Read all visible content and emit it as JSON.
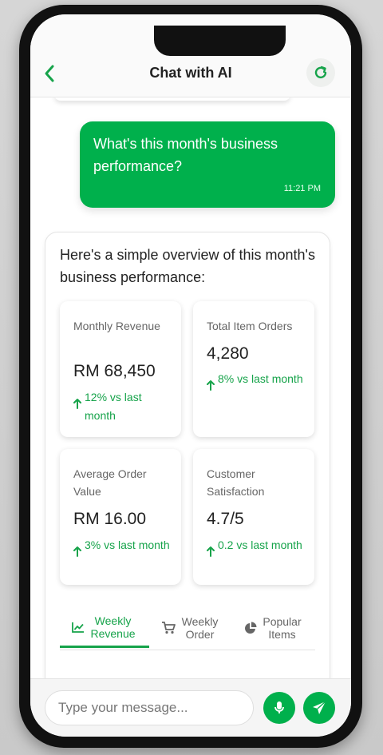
{
  "header": {
    "title": "Chat with AI"
  },
  "user_message": {
    "text": "What's this month's business performance?",
    "time": "11:21 PM"
  },
  "ai_message": {
    "intro": "Here's a simple overview of this month's business performance:",
    "metrics": [
      {
        "label": "Monthly Revenue",
        "value": "RM 68,450",
        "delta": "12% vs last month"
      },
      {
        "label": "Total Item Orders",
        "value": "4,280",
        "delta": "8% vs last month"
      },
      {
        "label": "Average Order Value",
        "value": "RM 16.00",
        "delta": "3% vs last month"
      },
      {
        "label": "Customer Satisfaction",
        "value": "4.7/5",
        "delta": "0.2 vs last month"
      }
    ],
    "tabs": [
      {
        "label": "Weekly Revenue",
        "icon": "line-chart-icon",
        "active": true
      },
      {
        "label": "Weekly Order",
        "icon": "cart-icon",
        "active": false
      },
      {
        "label": "Popular Items",
        "icon": "pie-chart-icon",
        "active": false
      }
    ]
  },
  "input": {
    "placeholder": "Type your message..."
  },
  "icons": {
    "back": "chevron-left-icon",
    "refresh": "refresh-icon",
    "mic": "microphone-icon",
    "send": "send-icon",
    "delta": "arrow-up-icon"
  },
  "colors": {
    "accent": "#00b04c",
    "positive": "#16a34a"
  }
}
